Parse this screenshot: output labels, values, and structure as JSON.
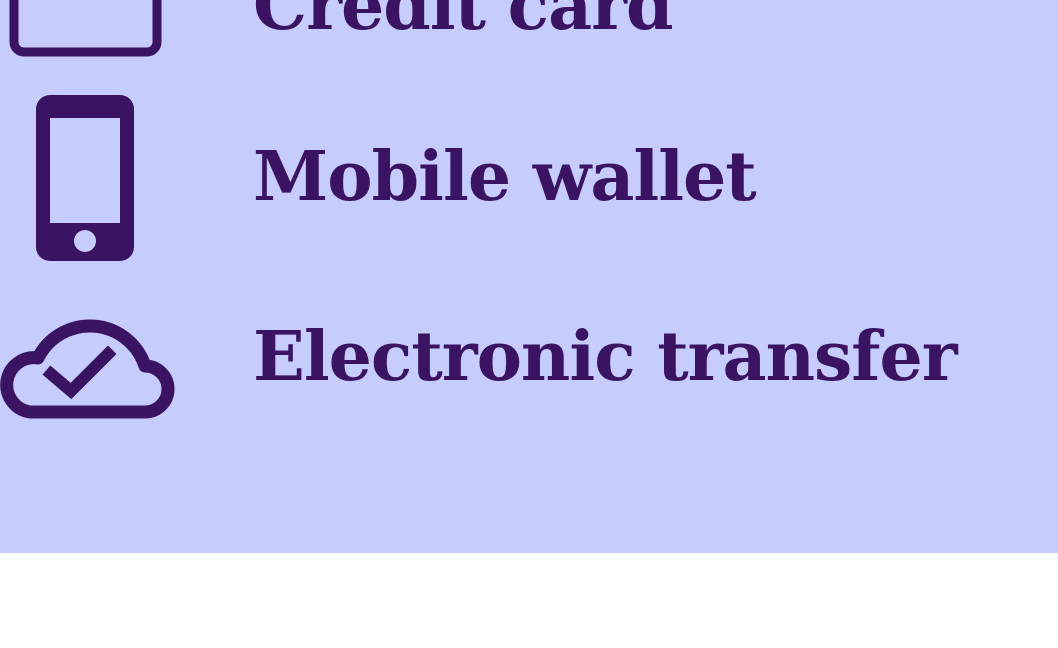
{
  "colors": {
    "panel_background": "#c7ccff",
    "ink": "#3a1463",
    "page_background": "#ffffff"
  },
  "payment_methods": {
    "items": [
      {
        "label": "Credit card",
        "icon": "credit-card-icon"
      },
      {
        "label": "Mobile wallet",
        "icon": "mobile-phone-icon"
      },
      {
        "label": "Electronic transfer",
        "icon": "cloud-check-icon"
      }
    ]
  }
}
